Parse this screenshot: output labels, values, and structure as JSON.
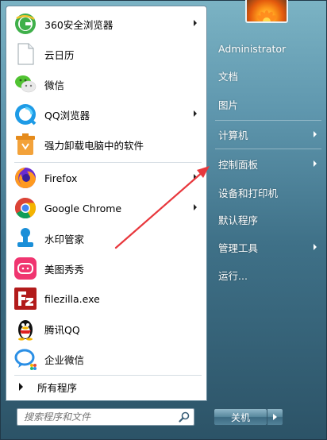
{
  "programs": [
    {
      "label": "360安全浏览器",
      "icon": "360-browser-icon",
      "has_submenu": true
    },
    {
      "label": "云日历",
      "icon": "blank-document-icon",
      "has_submenu": false
    },
    {
      "label": "微信",
      "icon": "wechat-icon",
      "has_submenu": false
    },
    {
      "label": "QQ浏览器",
      "icon": "qq-browser-icon",
      "has_submenu": true
    },
    {
      "label": "强力卸载电脑中的软件",
      "icon": "uninstaller-icon",
      "has_submenu": false
    },
    {
      "label": "Firefox",
      "icon": "firefox-icon",
      "has_submenu": true
    },
    {
      "label": "Google Chrome",
      "icon": "chrome-icon",
      "has_submenu": true
    },
    {
      "label": "水印管家",
      "icon": "watermark-icon",
      "has_submenu": false
    },
    {
      "label": "美图秀秀",
      "icon": "meitu-icon",
      "has_submenu": false
    },
    {
      "label": "filezilla.exe",
      "icon": "filezilla-icon",
      "has_submenu": false
    },
    {
      "label": "腾讯QQ",
      "icon": "qq-penguin-icon",
      "has_submenu": false
    },
    {
      "label": "企业微信",
      "icon": "wecom-icon",
      "has_submenu": false
    }
  ],
  "all_programs_label": "所有程序",
  "search": {
    "placeholder": "搜索程序和文件"
  },
  "user": {
    "name": "Administrator"
  },
  "right_menu": [
    {
      "label": "文档",
      "has_submenu": false
    },
    {
      "label": "图片",
      "has_submenu": false
    },
    {
      "label": "计算机",
      "has_submenu": true
    },
    {
      "label": "控制面板",
      "has_submenu": true
    },
    {
      "label": "设备和打印机",
      "has_submenu": false
    },
    {
      "label": "默认程序",
      "has_submenu": false
    },
    {
      "label": "管理工具",
      "has_submenu": true
    },
    {
      "label": "运行...",
      "has_submenu": false
    }
  ],
  "shutdown": {
    "label": "关机"
  },
  "annotation": {
    "color": "#e8383d",
    "points_to": "控制面板"
  }
}
